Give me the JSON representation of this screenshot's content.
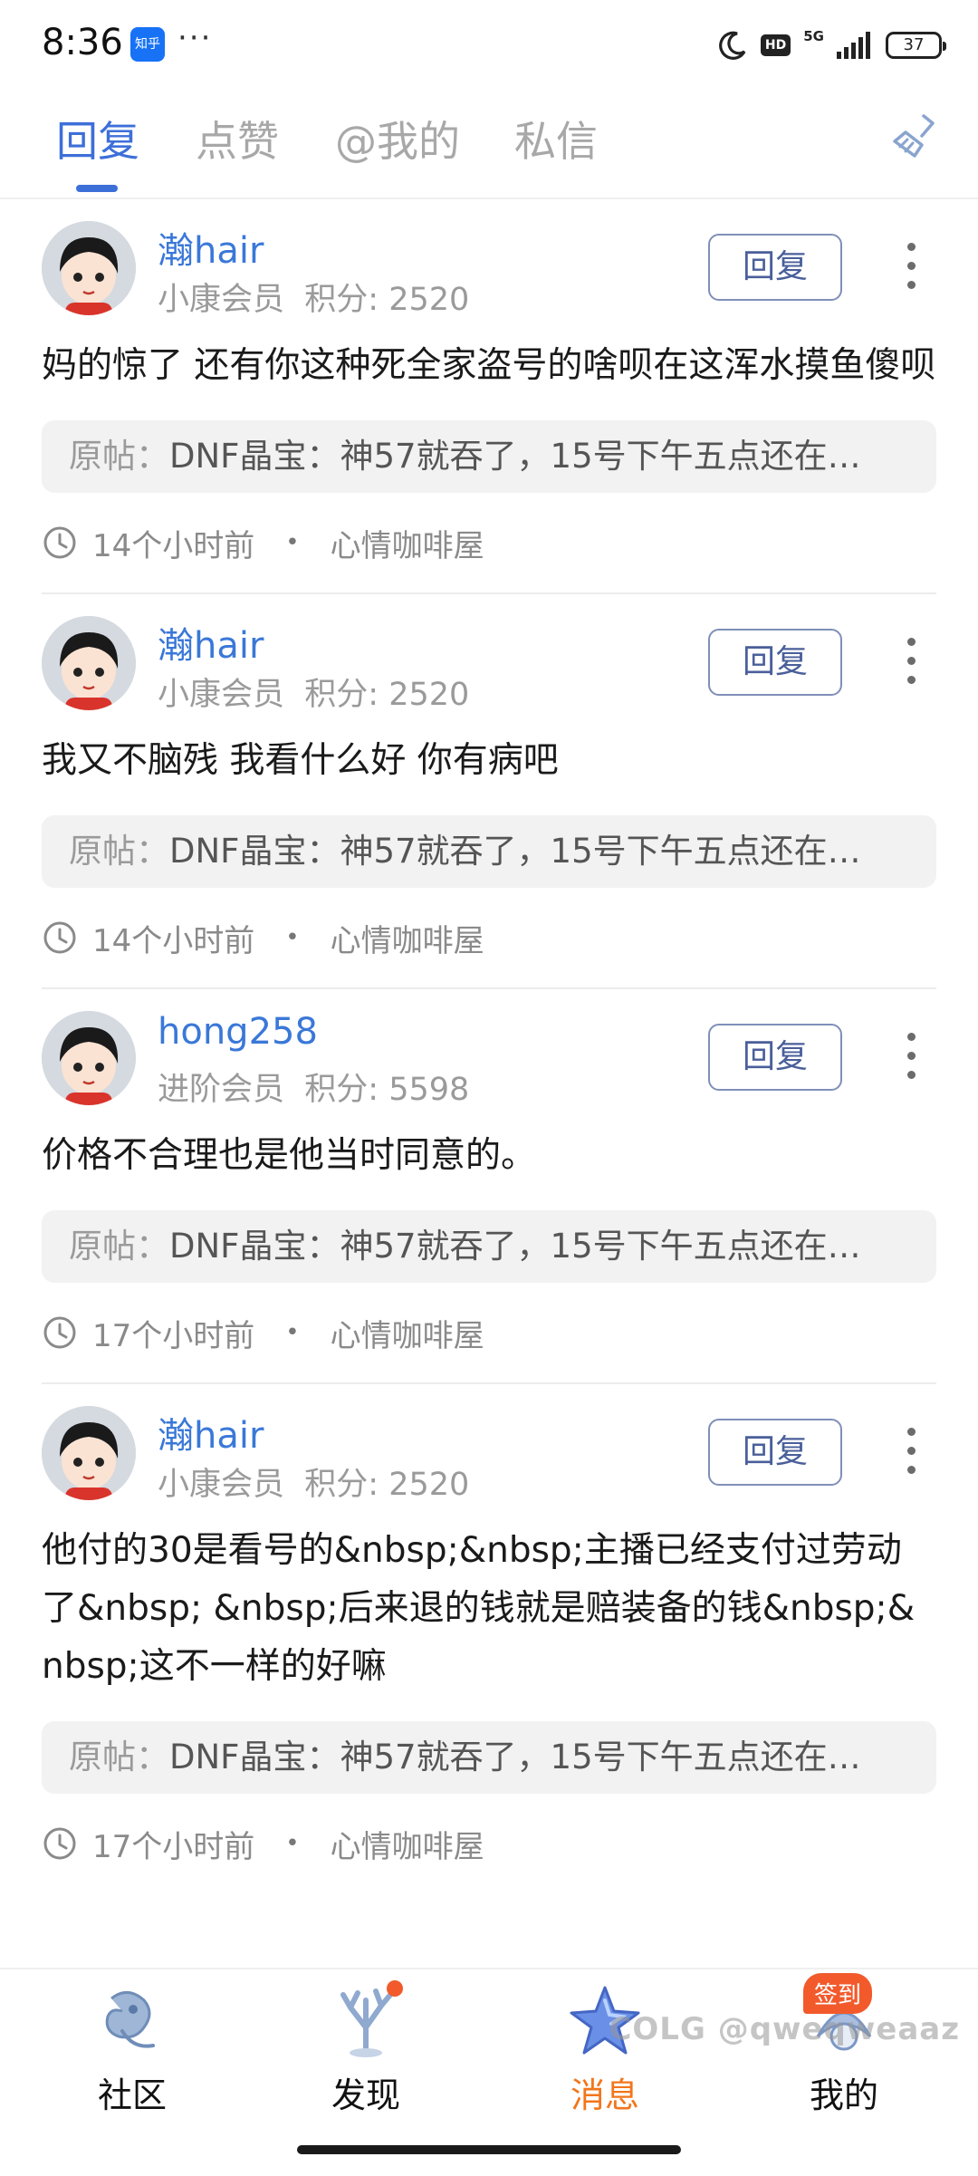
{
  "status_bar": {
    "time": "8:36",
    "app_badge": "知乎",
    "more": "···",
    "network": "5G",
    "hd": "HD",
    "battery": "37"
  },
  "tabs": [
    {
      "label": "回复",
      "active": true
    },
    {
      "label": "点赞",
      "active": false
    },
    {
      "label": "@我的",
      "active": false
    },
    {
      "label": "私信",
      "active": false
    }
  ],
  "clear_icon": "broom-icon",
  "cards": [
    {
      "user": "瀚hair",
      "level": "小康会员",
      "points": "积分: 2520",
      "reply_label": "回复",
      "content": "妈的惊了 还有你这种死全家盗号的啥呗在这浑水摸鱼傻呗",
      "quote_prefix": "原帖：",
      "quote": "DNF晶宝：神57就吞了，15号下午五点还在…",
      "time": "14个小时前",
      "board": "心情咖啡屋"
    },
    {
      "user": "瀚hair",
      "level": "小康会员",
      "points": "积分: 2520",
      "reply_label": "回复",
      "content": "我又不脑残 我看什么好 你有病吧",
      "quote_prefix": "原帖：",
      "quote": "DNF晶宝：神57就吞了，15号下午五点还在…",
      "time": "14个小时前",
      "board": "心情咖啡屋"
    },
    {
      "user": "hong258",
      "level": "进阶会员",
      "points": "积分: 5598",
      "reply_label": "回复",
      "content": "价格不合理也是他当时同意的。",
      "quote_prefix": "原帖：",
      "quote": "DNF晶宝：神57就吞了，15号下午五点还在…",
      "time": "17个小时前",
      "board": "心情咖啡屋"
    },
    {
      "user": "瀚hair",
      "level": "小康会员",
      "points": "积分: 2520",
      "reply_label": "回复",
      "content": "他付的30是看号的&nbsp;&nbsp;主播已经支付过劳动了&nbsp; &nbsp;后来退的钱就是赔装备的钱&nbsp;&nbsp;这不一样的好嘛",
      "quote_prefix": "原帖：",
      "quote": "DNF晶宝：神57就吞了，15号下午五点还在…",
      "time": "17个小时前",
      "board": "心情咖啡屋"
    }
  ],
  "bottom_nav": [
    {
      "label": "社区",
      "icon": "community-icon",
      "active": false
    },
    {
      "label": "发现",
      "icon": "discover-icon",
      "active": false
    },
    {
      "label": "消息",
      "icon": "message-star-icon",
      "active": true
    },
    {
      "label": "我的",
      "icon": "profile-icon",
      "active": false
    }
  ],
  "sign_in_badge": "签到",
  "watermark": "COLG @qweqweaaz",
  "colors": {
    "accent_blue": "#3d6fd9",
    "username_blue": "#3a78d8",
    "active_nav_orange": "#f2761c",
    "badge_red": "#f25a2c"
  }
}
